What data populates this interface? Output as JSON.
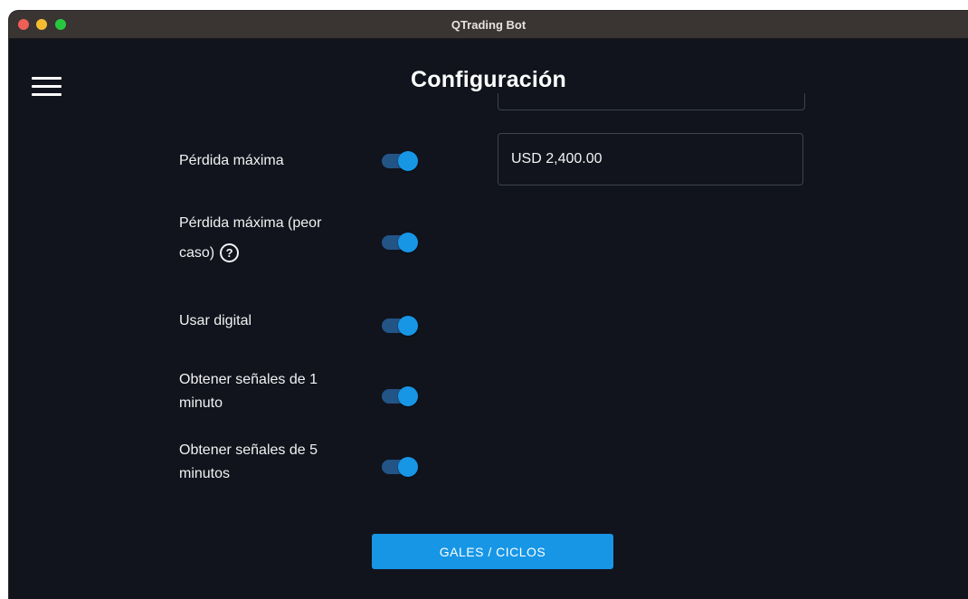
{
  "window": {
    "title": "QTrading Bot"
  },
  "header": {
    "title": "Configuración"
  },
  "settings": {
    "max_loss": {
      "label": "Pérdida máxima",
      "enabled": true,
      "value": "USD 2,400.00"
    },
    "max_loss_worst": {
      "label_line1": "Pérdida máxima (peor",
      "label_line2": "caso)",
      "help_icon": "?",
      "enabled": true
    },
    "use_digital": {
      "label": "Usar digital",
      "enabled": true
    },
    "signals_1min": {
      "label_line1": "Obtener señales de 1",
      "label_line2": "minuto",
      "enabled": true
    },
    "signals_5min": {
      "label_line1": "Obtener señales de 5",
      "label_line2": "minutos",
      "enabled": true
    }
  },
  "actions": {
    "gales_button": "GALES / CICLOS"
  },
  "icons": {
    "menu": "hamburger-icon",
    "help": "question-circle-icon"
  },
  "colors": {
    "background": "#11141d",
    "accent": "#1796e6",
    "toggle_track": "#235486",
    "titlebar": "#3a3433"
  }
}
